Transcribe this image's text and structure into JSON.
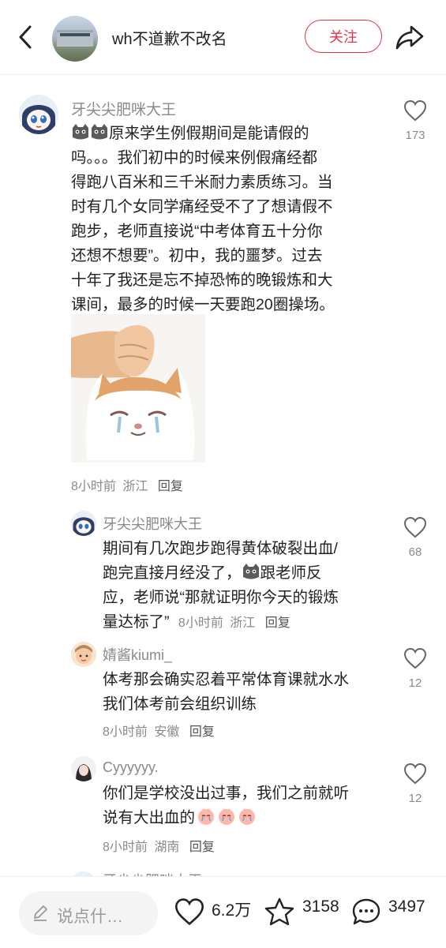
{
  "header": {
    "title": "wh不道歉不改名",
    "follow_label": "关注"
  },
  "comments": [
    {
      "username": "牙尖尖肥咪大王",
      "text_lines": [
        "原来学生例假期间是能请假的",
        "吗。。。我们初中的时候来例假痛经都",
        "得跑八百米和三千米耐力素质练习。当",
        "时有几个女同学痛经受不了了想请假不",
        "跑步，老师直接说“中考体育五十分你",
        "还想不想要”。初中，我的噩梦。过去",
        "十年了我还是忘不掉恐怖的晚锻炼和大",
        "课间，最多的时候一天要跑20圈操场。"
      ],
      "time": "8小时前",
      "location": "浙江",
      "reply_label": "回复",
      "likes": "173"
    }
  ],
  "replies": [
    {
      "username": "牙尖尖肥咪大王",
      "text_lines": [
        "期间有几次跑步跑得黄体破裂出血/",
        "跑完直接月经没了，",
        "应，老师说“那就证明你今天的锻炼",
        "量达标了”"
      ],
      "line2_after": "跟老师反",
      "time": "8小时前",
      "location": "浙江",
      "reply_label": "回复",
      "likes": "68"
    },
    {
      "username": "婧酱kiumi_",
      "text_lines": [
        "体考那会确实忍着平常体育课就水水",
        "我们体考前会组织训练"
      ],
      "time": "8小时前",
      "location": "安徽",
      "reply_label": "回复",
      "likes": "12"
    },
    {
      "username": "Cyyyyyy.",
      "text_lines": [
        "你们是学校没出过事，我们之前就听",
        "说有大出血的"
      ],
      "time": "8小时前",
      "location": "湖南",
      "reply_label": "回复",
      "likes": "12"
    },
    {
      "username": "牙尖尖肥咪大王"
    }
  ],
  "bottom": {
    "comment_placeholder": "说点什…",
    "likes": "6.2万",
    "favorites": "3158",
    "comments": "3497"
  },
  "icons": {
    "back": "chevron-left-icon",
    "share": "share-arrow-icon",
    "heart": "heart-outline-icon",
    "star": "star-outline-icon",
    "chat": "chat-bubble-icon",
    "pen": "pen-icon"
  },
  "colors": {
    "accent": "#e0344b",
    "muted": "#8a8a8a",
    "text": "#222222"
  }
}
